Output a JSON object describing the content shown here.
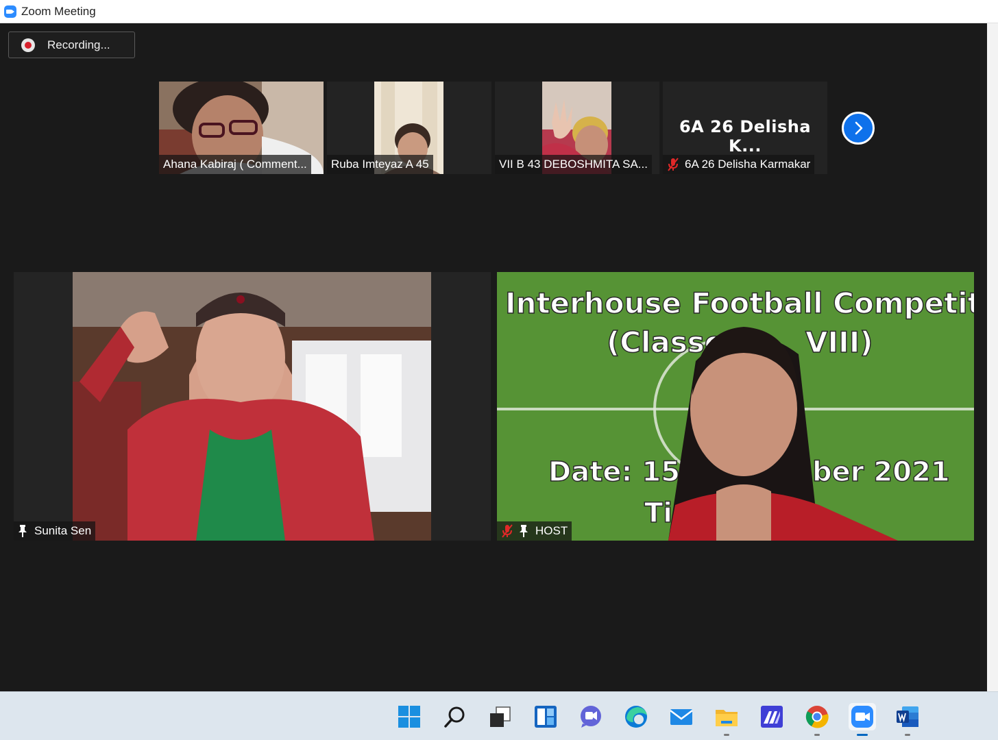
{
  "window": {
    "title": "Zoom Meeting"
  },
  "recording": {
    "label": "Recording..."
  },
  "thumbnails": [
    {
      "name": "Ahana Kabiraj ( Comment..."
    },
    {
      "name": "Ruba Imteyaz  A 45"
    },
    {
      "name": "VII B 43 DEBOSHMITA SA..."
    },
    {
      "name": "6A 26 Delisha Karmakar",
      "display": "6A 26 Delisha K...",
      "muted": true
    }
  ],
  "main_tiles": [
    {
      "name": "Sunita Sen",
      "pinned": true
    },
    {
      "name": "HOST",
      "pinned": true,
      "muted": true,
      "poster": {
        "line1": "Interhouse Football Competition.",
        "line2": "(Classe",
        "line3": "VIII)",
        "line4a": "Date: 15t",
        "line4b": "ber 2021",
        "line5": "Ti"
      }
    }
  ],
  "taskbar": {
    "items": [
      "start-icon",
      "search-icon",
      "task-view-icon",
      "widgets-icon",
      "chat-icon",
      "edge-icon",
      "mail-icon",
      "file-explorer-icon",
      "ms-app-icon",
      "chrome-icon",
      "zoom-icon",
      "word-icon"
    ]
  },
  "colors": {
    "accent": "#0e71eb",
    "background": "#1a1a1a",
    "tile": "#232323",
    "recording_dot": "#d6202c",
    "muted_mic": "#e02828"
  }
}
